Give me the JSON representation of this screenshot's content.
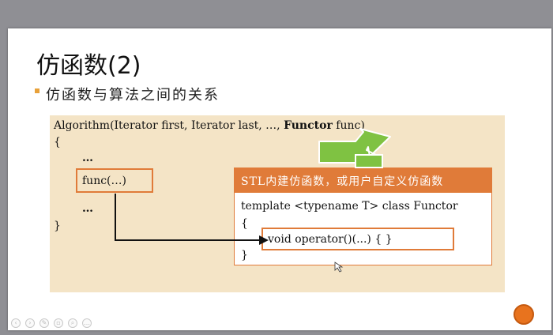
{
  "slide": {
    "title": "仿函数(2)",
    "bullet": "仿函数与算法之间的关系"
  },
  "code": {
    "signature_prefix": "Algorithm(Iterator first, Iterator last, …, ",
    "signature_functor": "Functor",
    "signature_suffix": " func)",
    "open_brace": "{",
    "ellipsis_top": "…",
    "func_call": "func(…)",
    "ellipsis_bottom": "…",
    "close_brace": "}"
  },
  "stl_box": {
    "header": "STL内建仿函数，或用户自定义仿函数",
    "template_line": "template <typename T> class Functor",
    "open_brace": "{",
    "operator_line": "void operator()(...) { }",
    "close_brace": "}"
  },
  "colors": {
    "accent_orange": "#e07b39",
    "panel_bg": "#f4e4c6",
    "arrow_green": "#7fc242",
    "bullet_square": "#e8a13a"
  },
  "toolbar": {
    "icons": [
      "prev-icon",
      "next-icon",
      "pen-icon",
      "copy-icon",
      "zoom-icon",
      "more-icon"
    ]
  }
}
